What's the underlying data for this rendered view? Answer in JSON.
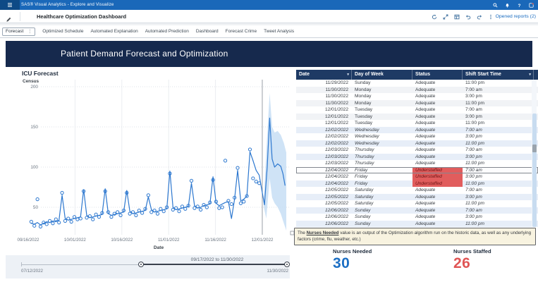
{
  "app_bar": {
    "title": "SAS® Visual Analytics - Explore and Visualize",
    "right_icons": [
      "search-icon",
      "notifications-icon",
      "help-icon",
      "avatar"
    ]
  },
  "toolbar": {
    "report_title": "Healthcare Optimization Dashboard",
    "left_icon": "edit-pencil-icon",
    "right_icons": [
      "refresh-icon",
      "expand-icon",
      "report-view-icon",
      "undo-icon",
      "redo-icon",
      "more-options-icon"
    ],
    "opened_reports_label": "Opened reports (2)"
  },
  "tabs": {
    "selected": "Forecast",
    "items": [
      "Forecast",
      "Optimized Schedule",
      "Automated Explanation",
      "Automated Prediction",
      "Dashboard",
      "Forecast Crime",
      "Tweet Analysis"
    ]
  },
  "banner": {
    "title": "Patient Demand Forecast and Optimization"
  },
  "chart_data": {
    "type": "line",
    "title": "ICU Forecast",
    "ylabel": "Census",
    "xlabel": "Date",
    "x_ticks": [
      "09/16/2022",
      "10/01/2022",
      "10/16/2022",
      "11/01/2022",
      "11/16/2022",
      "12/01/2022"
    ],
    "y_ticks": [
      50,
      100,
      150,
      200
    ],
    "ylim": [
      15,
      210
    ],
    "x_origin_date": "09/16/2022",
    "days_per_tick": 15,
    "reference_line_day": 76,
    "series": [
      {
        "name": "fitted_line",
        "start_day": 1,
        "values": [
          30,
          29,
          31,
          28,
          30,
          32,
          31,
          33,
          32,
          34,
          65,
          36,
          34,
          35,
          36,
          37,
          38,
          72,
          40,
          37,
          38,
          39,
          40,
          41,
          73,
          42,
          40,
          41,
          42,
          43,
          44,
          71,
          45,
          42,
          43,
          44,
          45,
          46,
          63,
          47,
          44,
          45,
          46,
          47,
          48,
          95,
          50,
          47,
          48,
          49,
          50,
          51,
          80,
          52,
          49,
          50,
          52,
          53,
          54,
          88,
          55,
          52,
          54,
          56,
          57,
          36,
          60,
          96,
          58,
          60,
          64,
          119,
          108,
          96,
          90
        ]
      },
      {
        "name": "actual_census_scatter",
        "start_day": 1,
        "values": [
          32,
          27,
          60,
          26,
          31,
          29,
          33,
          30,
          35,
          31,
          68,
          33,
          36,
          32,
          38,
          35,
          36,
          70,
          37,
          39,
          35,
          41,
          38,
          43,
          70,
          44,
          38,
          42,
          44,
          40,
          46,
          68,
          42,
          44,
          40,
          46,
          43,
          48,
          65,
          44,
          46,
          42,
          48,
          45,
          50,
          92,
          47,
          49,
          45,
          51,
          48,
          52,
          83,
          49,
          51,
          47,
          53,
          50,
          56,
          84,
          57,
          49,
          50,
          108,
          58,
          54,
          62,
          99,
          55,
          57,
          64,
          122,
          86,
          82,
          80
        ]
      },
      {
        "name": "forecast_line",
        "points": [
          [
            75,
            90
          ],
          [
            76.7,
            53
          ],
          [
            77.6,
            100
          ],
          [
            78.4,
            161
          ],
          [
            79.2,
            110
          ],
          [
            80,
            100
          ],
          [
            81,
            104
          ],
          [
            82,
            101
          ],
          [
            82.7,
            92
          ],
          [
            83.4,
            77
          ]
        ]
      },
      {
        "name": "confidence_band",
        "points": [
          [
            76.5,
            50,
            58
          ],
          [
            77.3,
            36,
            120
          ],
          [
            78.4,
            86,
            192
          ],
          [
            79.2,
            62,
            150
          ],
          [
            80,
            55,
            143
          ],
          [
            81,
            50,
            145
          ],
          [
            82,
            42,
            140
          ],
          [
            83,
            30,
            130
          ],
          [
            83.8,
            21,
            118
          ]
        ]
      }
    ],
    "colors": {
      "line": "#2c77cf",
      "band": "#c7def5",
      "reference": "#9aa0a8"
    }
  },
  "slider": {
    "range_label": "09/17/2022 to 11/30/2022",
    "min_label": "07/12/2022",
    "max_label": "11/30/2022"
  },
  "table": {
    "columns": [
      "Date",
      "Day of Week",
      "Status",
      "Shift Start Time"
    ],
    "sorted_columns": [
      0,
      3
    ],
    "rows": [
      {
        "date": "11/29/2022",
        "day": "Sunday",
        "status": "Adequate",
        "shift": "11:00 pm",
        "forecast": false,
        "selected": false
      },
      {
        "date": "11/30/2022",
        "day": "Monday",
        "status": "Adequate",
        "shift": "7:00 am",
        "forecast": false,
        "selected": false
      },
      {
        "date": "11/30/2022",
        "day": "Monday",
        "status": "Adequate",
        "shift": "3:00 pm",
        "forecast": false,
        "selected": false
      },
      {
        "date": "11/30/2022",
        "day": "Monday",
        "status": "Adequate",
        "shift": "11:00 pm",
        "forecast": false,
        "selected": false
      },
      {
        "date": "12/01/2022",
        "day": "Tuesday",
        "status": "Adequate",
        "shift": "7:00 am",
        "forecast": false,
        "selected": false
      },
      {
        "date": "12/01/2022",
        "day": "Tuesday",
        "status": "Adequate",
        "shift": "3:00 pm",
        "forecast": false,
        "selected": false
      },
      {
        "date": "12/01/2022",
        "day": "Tuesday",
        "status": "Adequate",
        "shift": "11:00 pm",
        "forecast": false,
        "selected": false
      },
      {
        "date": "12/02/2022",
        "day": "Wednesday",
        "status": "Adequate",
        "shift": "7:00 am",
        "forecast": true,
        "selected": false
      },
      {
        "date": "12/02/2022",
        "day": "Wednesday",
        "status": "Adequate",
        "shift": "3:00 pm",
        "forecast": true,
        "selected": false
      },
      {
        "date": "12/02/2022",
        "day": "Wednesday",
        "status": "Adequate",
        "shift": "11:00 pm",
        "forecast": true,
        "selected": false
      },
      {
        "date": "12/03/2022",
        "day": "Thursday",
        "status": "Adequate",
        "shift": "7:00 am",
        "forecast": true,
        "selected": false
      },
      {
        "date": "12/03/2022",
        "day": "Thursday",
        "status": "Adequate",
        "shift": "3:00 pm",
        "forecast": true,
        "selected": false
      },
      {
        "date": "12/03/2022",
        "day": "Thursday",
        "status": "Adequate",
        "shift": "11:00 pm",
        "forecast": true,
        "selected": false
      },
      {
        "date": "12/04/2022",
        "day": "Friday",
        "status": "Understaffed",
        "shift": "7:00 am",
        "forecast": true,
        "selected": true
      },
      {
        "date": "12/04/2022",
        "day": "Friday",
        "status": "Understaffed",
        "shift": "3:00 pm",
        "forecast": true,
        "selected": false
      },
      {
        "date": "12/04/2022",
        "day": "Friday",
        "status": "Understaffed",
        "shift": "11:00 pm",
        "forecast": true,
        "selected": false
      },
      {
        "date": "12/05/2022",
        "day": "Saturday",
        "status": "Adequate",
        "shift": "7:00 am",
        "forecast": true,
        "selected": false
      },
      {
        "date": "12/05/2022",
        "day": "Saturday",
        "status": "Adequate",
        "shift": "3:00 pm",
        "forecast": true,
        "selected": false
      },
      {
        "date": "12/05/2022",
        "day": "Saturday",
        "status": "Adequate",
        "shift": "11:00 pm",
        "forecast": true,
        "selected": false
      },
      {
        "date": "12/06/2022",
        "day": "Sunday",
        "status": "Adequate",
        "shift": "7:00 am",
        "forecast": true,
        "selected": false
      },
      {
        "date": "12/06/2022",
        "day": "Sunday",
        "status": "Adequate",
        "shift": "3:00 pm",
        "forecast": true,
        "selected": false
      },
      {
        "date": "12/06/2022",
        "day": "Sunday",
        "status": "Adequate",
        "shift": "11:00 pm",
        "forecast": true,
        "selected": false
      }
    ]
  },
  "note": {
    "prefix": "The ",
    "highlight": "Nurses Needed",
    "suffix": " value is an output of the Optimization algorithm run on the historic data, as well as any underlying factors (crime, flu, weather, etc.)"
  },
  "kpis": [
    {
      "label": "Nurses Needed",
      "value": "30",
      "color": "#1c6fc4"
    },
    {
      "label": "Nurses Staffed",
      "value": "26",
      "color": "#e05555"
    }
  ],
  "status_colors": {
    "understaffed_bg": "#e15d5d"
  }
}
